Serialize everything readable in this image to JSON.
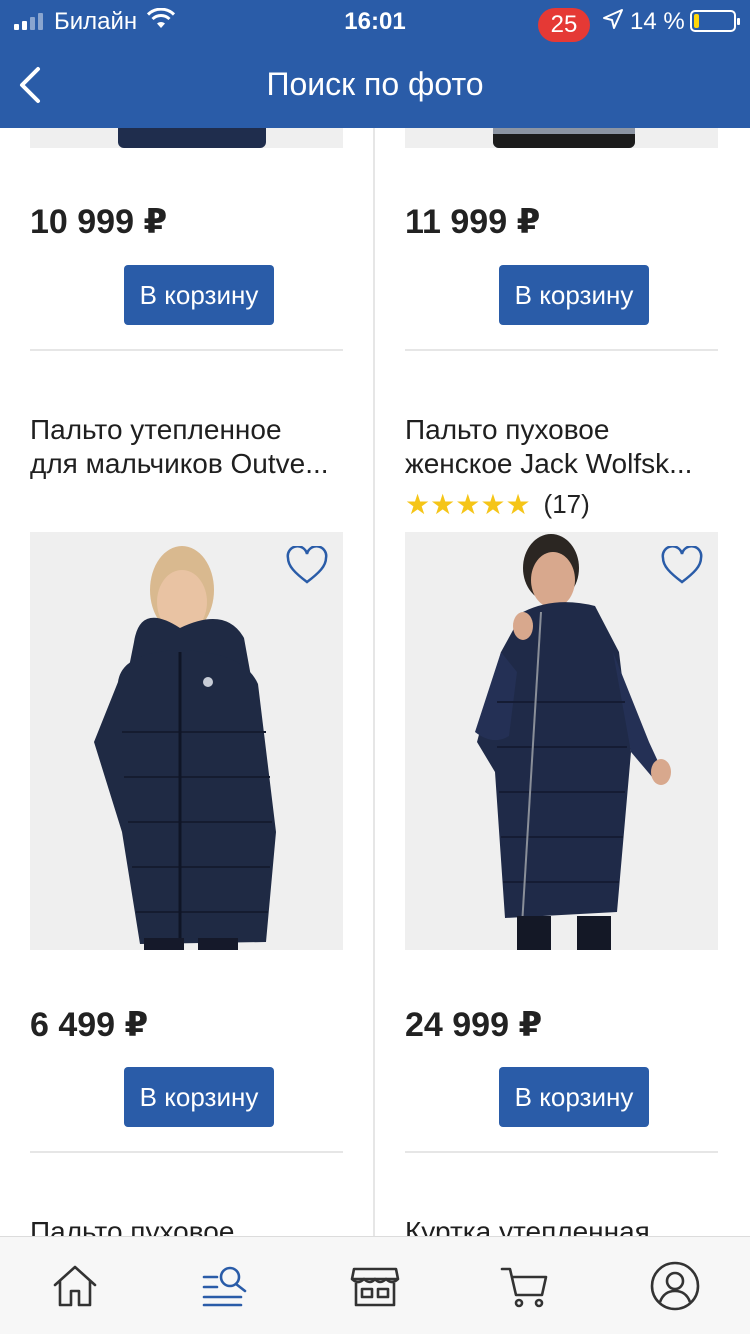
{
  "status_bar": {
    "carrier": "Билайн",
    "time": "16:01",
    "battery": "14 %",
    "battery_level": 0.14,
    "icons": [
      "signal-icon",
      "wifi-icon",
      "location-arrow-icon",
      "battery-icon"
    ]
  },
  "header": {
    "title": "Поиск по фото",
    "back_icon": "chevron-left-icon"
  },
  "products": [
    {
      "price": "10 999 ₽",
      "button": "В корзину"
    },
    {
      "price": "11 999 ₽",
      "button": "В корзину"
    },
    {
      "name_line1": "Пальто утепленное",
      "name_line2": "для мальчиков Outve...",
      "price": "6 499 ₽",
      "button": "В корзину",
      "favorite_icon": "heart-outline-icon"
    },
    {
      "name_line1": "Пальто пуховое",
      "name_line2": "женское Jack Wolfsk...",
      "rating": 5,
      "rating_count": "(17)",
      "price": "24 999 ₽",
      "button": "В корзину",
      "favorite_icon": "heart-outline-icon"
    },
    {
      "name_line1": "Пальто пуховое"
    },
    {
      "name_line1": "Куртка утепленная"
    }
  ],
  "tab_bar": {
    "tabs": [
      "home-icon",
      "search-list-icon",
      "store-icon",
      "cart-icon",
      "profile-icon"
    ],
    "cart_badge": "25",
    "active_tab": "search-list-icon"
  },
  "colors": {
    "brand": "#2a5ca8",
    "badge": "#e53935",
    "star": "#f5c518"
  }
}
